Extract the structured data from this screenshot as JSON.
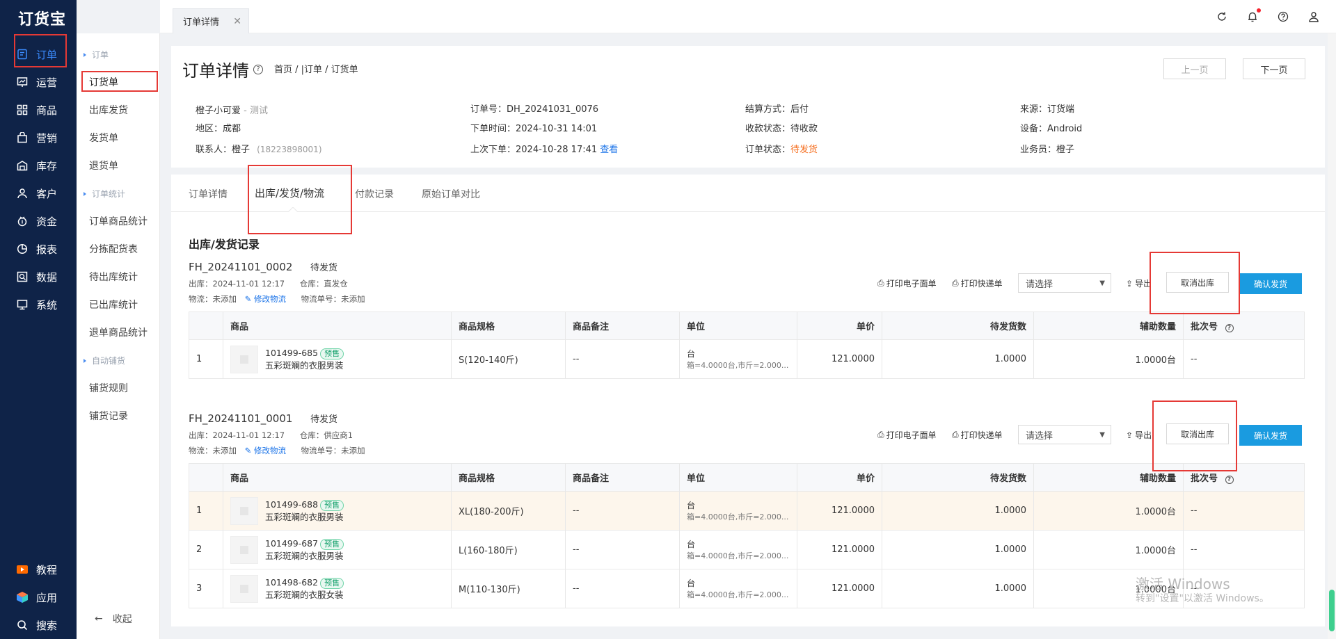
{
  "app": {
    "logo": "订货宝"
  },
  "nav": {
    "items": [
      {
        "label": "订单",
        "icon": "order-icon"
      },
      {
        "label": "运营",
        "icon": "operation-icon"
      },
      {
        "label": "商品",
        "icon": "goods-icon"
      },
      {
        "label": "营销",
        "icon": "marketing-icon"
      },
      {
        "label": "库存",
        "icon": "warehouse-icon"
      },
      {
        "label": "客户",
        "icon": "customer-icon"
      },
      {
        "label": "资金",
        "icon": "fund-icon"
      },
      {
        "label": "报表",
        "icon": "report-icon"
      },
      {
        "label": "数据",
        "icon": "data-icon"
      },
      {
        "label": "系统",
        "icon": "system-icon"
      }
    ],
    "bottom": [
      {
        "label": "教程",
        "icon": "tutorial-icon"
      },
      {
        "label": "应用",
        "icon": "apps-icon"
      },
      {
        "label": "搜索",
        "icon": "search-icon"
      }
    ]
  },
  "subnav": {
    "group_order": "订单",
    "items_order": [
      "订货单",
      "出库发货",
      "发货单",
      "退货单"
    ],
    "group_stats": "订单统计",
    "items_stats": [
      "订单商品统计",
      "分拣配货表",
      "待出库统计",
      "已出库统计",
      "退单商品统计"
    ],
    "group_auto": "自动铺货",
    "items_auto": [
      "铺货规则",
      "铺货记录"
    ],
    "collapse": "收起"
  },
  "topbar": {
    "tab_label": "订单详情"
  },
  "header": {
    "title": "订单详情",
    "breadcrumb": "首页 / |订单 / 订货单",
    "prev": "上一页",
    "next": "下一页"
  },
  "info": {
    "customer": "橙子小可爱",
    "customer_note": "- 测试",
    "region": "地区：成都",
    "contact_label": "联系人：橙子",
    "contact_phone": "(18223898001)",
    "order_no": "订单号：DH_20241031_0076",
    "order_time": "下单时间：2024-10-31 14:01",
    "last_order": "上次下单：2024-10-28 17:41",
    "last_order_link": "查看",
    "settle": "结算方式：后付",
    "pay_status": "收款状态：待收款",
    "order_status_label": "订单状态：",
    "order_status": "待发货",
    "source": "来源：订货端",
    "device": "设备：Android",
    "salesman": "业务员：橙子"
  },
  "tabs": [
    "订单详情",
    "出库/发货/物流",
    "付款记录",
    "原始订单对比"
  ],
  "section_title": "出库/发货记录",
  "columns": [
    "商品",
    "商品规格",
    "商品备注",
    "单位",
    "单价",
    "待发货数",
    "辅助数量",
    "批次号"
  ],
  "toolbar": {
    "print_e": "打印电子面单",
    "print_express": "打印快递单",
    "select_placeholder": "请选择",
    "export": "导出",
    "cancel": "取消出库",
    "confirm": "确认发货"
  },
  "shipments": [
    {
      "no": "FH_20241101_0002",
      "status": "待发货",
      "out_time": "出库：2024-11-01 12:17",
      "warehouse": "仓库：直发仓",
      "logistics": "物流：未添加",
      "edit": "修改物流",
      "track": "物流单号：未添加",
      "rows": [
        {
          "idx": "1",
          "code": "101499-685",
          "tag": "预售",
          "name": "五彩斑斓的衣服男装",
          "spec": "S(120-140斤)",
          "remark": "--",
          "unit": "台",
          "unit_sub": "箱=4.0000台,市斤=2.000...",
          "price": "121.0000",
          "qty": "1.0000",
          "aux": "1.0000台",
          "batch": "--"
        }
      ]
    },
    {
      "no": "FH_20241101_0001",
      "status": "待发货",
      "out_time": "出库：2024-11-01 12:17",
      "warehouse": "仓库：供应商1",
      "logistics": "物流：未添加",
      "edit": "修改物流",
      "track": "物流单号：未添加",
      "rows": [
        {
          "idx": "1",
          "code": "101499-688",
          "tag": "预售",
          "name": "五彩斑斓的衣服男装",
          "spec": "XL(180-200斤)",
          "remark": "--",
          "unit": "台",
          "unit_sub": "箱=4.0000台,市斤=2.000...",
          "price": "121.0000",
          "qty": "1.0000",
          "aux": "1.0000台",
          "batch": "--"
        },
        {
          "idx": "2",
          "code": "101499-687",
          "tag": "预售",
          "name": "五彩斑斓的衣服男装",
          "spec": "L(160-180斤)",
          "remark": "--",
          "unit": "台",
          "unit_sub": "箱=4.0000台,市斤=2.000...",
          "price": "121.0000",
          "qty": "1.0000",
          "aux": "1.0000台",
          "batch": "--"
        },
        {
          "idx": "3",
          "code": "101498-682",
          "tag": "预售",
          "name": "五彩斑斓的衣服女装",
          "spec": "M(110-130斤)",
          "remark": "--",
          "unit": "台",
          "unit_sub": "箱=4.0000台,市斤=2.000...",
          "price": "121.0000",
          "qty": "1.0000",
          "aux": "1.0000台",
          "batch": "--"
        }
      ]
    }
  ],
  "watermark": {
    "line1": "激活 Windows",
    "line2": "转到\"设置\"以激活 Windows。"
  },
  "colors": {
    "nav_bg": "#0f2348",
    "accent": "#1a9be0",
    "status_orange": "#f56c1b",
    "annotation_red": "#e53935"
  }
}
